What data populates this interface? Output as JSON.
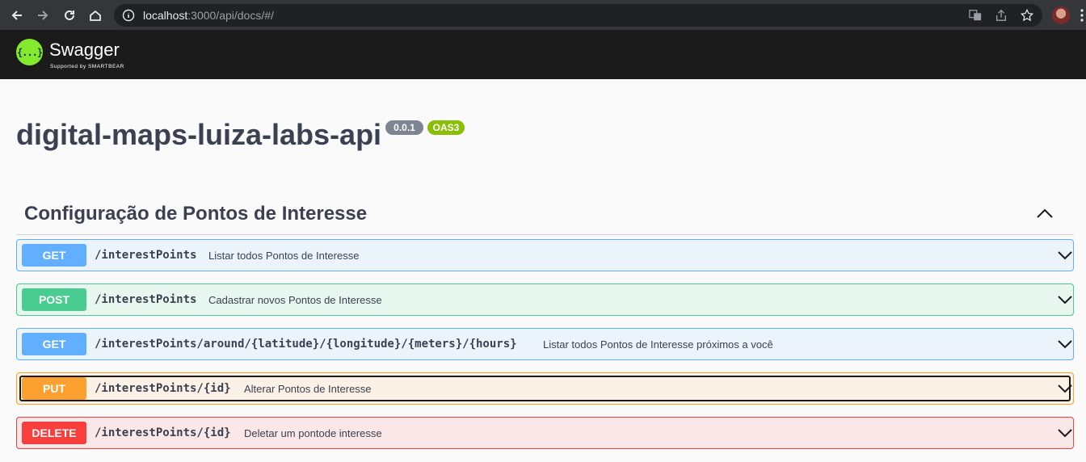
{
  "browser": {
    "url_host": "localhost",
    "url_rest": ":3000/api/docs/#/",
    "icons": [
      "back-arrow-icon",
      "forward-arrow-icon",
      "reload-icon",
      "home-icon",
      "info-icon",
      "translate-icon",
      "share-icon",
      "star-icon",
      "avatar",
      "kebab-menu-icon"
    ]
  },
  "swagger": {
    "logo_text": "Swagger",
    "logo_sub": "Supported by SMARTBEAR",
    "logo_glyph": "{...}"
  },
  "info": {
    "title": "digital-maps-luiza-labs-api",
    "version": "0.0.1",
    "oas": "OAS3"
  },
  "tag": {
    "name": "Configuração de Pontos de Interesse"
  },
  "operations": [
    {
      "method": "GET",
      "path": "/interestPoints",
      "summary": "Listar todos Pontos de Interesse"
    },
    {
      "method": "POST",
      "path": "/interestPoints",
      "summary": "Cadastrar novos Pontos de Interesse"
    },
    {
      "method": "GET",
      "path": "/interestPoints/around/{latitude}/{longitude}/{meters}/{hours}",
      "summary": "Listar todos Pontos de Interesse próximos a você"
    },
    {
      "method": "PUT",
      "path": "/interestPoints/{id}",
      "summary": "Alterar Pontos de Interesse"
    },
    {
      "method": "DELETE",
      "path": "/interestPoints/{id}",
      "summary": "Deletar um pontode interesse"
    }
  ],
  "colors": {
    "get": "#61affe",
    "post": "#49cc90",
    "put": "#fca130",
    "delete": "#f93e3e",
    "swagger_green": "#85ea2d",
    "topbar": "#1b1b1b"
  }
}
